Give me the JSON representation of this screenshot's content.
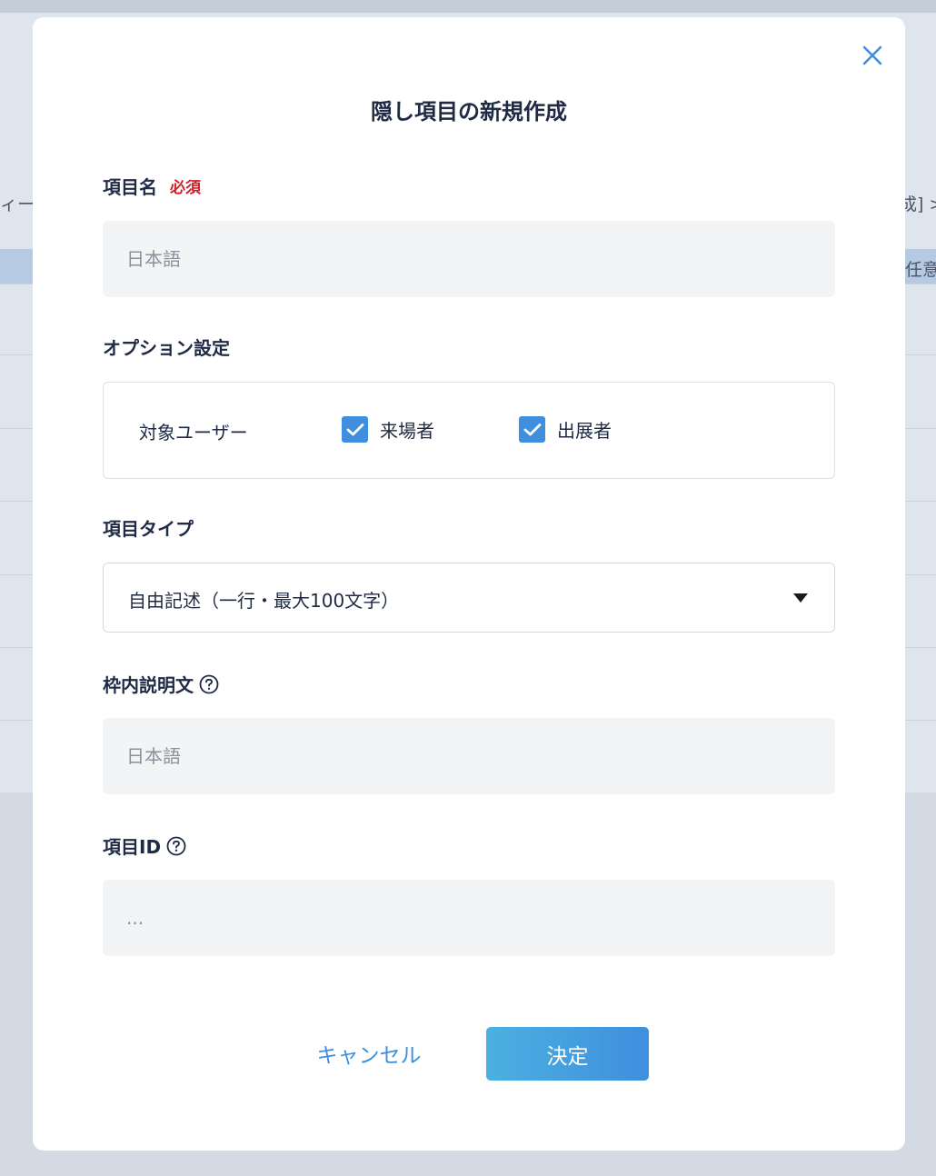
{
  "background": {
    "left_fragment": "ィー",
    "right_fragment": "成] >",
    "right_fragment_2": "任意"
  },
  "modal": {
    "title": "隠し項目の新規作成",
    "close_icon": "close-icon",
    "field_name": {
      "label": "項目名",
      "required_badge": "必須",
      "placeholder": "日本語",
      "value": ""
    },
    "options": {
      "label": "オプション設定",
      "target_users_label": "対象ユーザー",
      "checkboxes": [
        {
          "label": "来場者",
          "checked": true
        },
        {
          "label": "出展者",
          "checked": true
        }
      ]
    },
    "field_type": {
      "label": "項目タイプ",
      "selected": "自由記述（一行・最大100文字）",
      "arrow_icon": "caret-down-icon"
    },
    "placeholder_text": {
      "label": "枠内説明文",
      "help_icon": "question-circle-icon",
      "placeholder": "日本語",
      "value": ""
    },
    "field_id": {
      "label": "項目ID",
      "help_icon": "question-circle-icon",
      "placeholder": "...",
      "value": ""
    },
    "buttons": {
      "cancel": "キャンセル",
      "submit": "決定"
    }
  },
  "colors": {
    "accent": "#3f8fde",
    "required": "#d0202a",
    "text": "#1f2a44",
    "input_bg": "#f3f4f6"
  }
}
